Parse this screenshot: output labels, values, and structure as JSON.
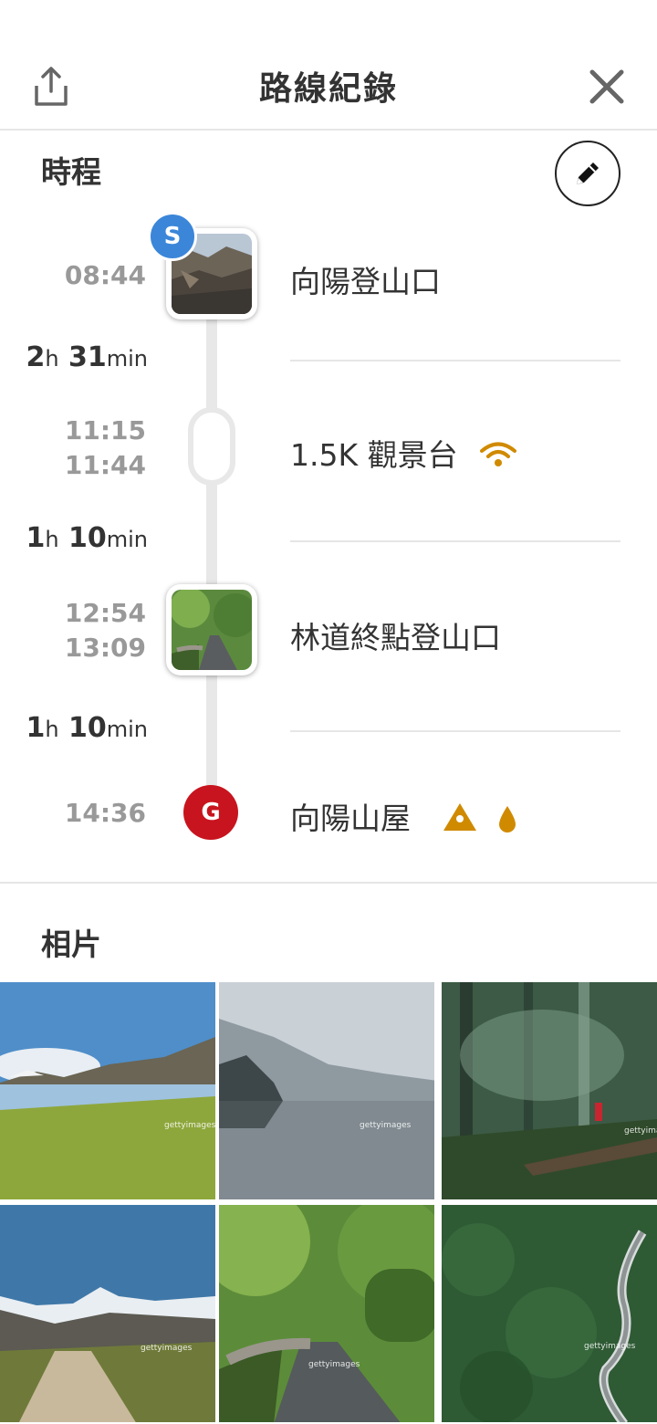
{
  "header": {
    "title": "路線紀錄",
    "share_icon": "share-icon",
    "close_icon": "close-icon"
  },
  "schedule": {
    "section_title": "時程",
    "edit_icon": "pencil-icon",
    "start_badge": "S",
    "goal_badge": "G",
    "stops": [
      {
        "times": [
          "08:44"
        ],
        "name": "向陽登山口"
      },
      {
        "times": [
          "11:15",
          "11:44"
        ],
        "name": "1.5K 觀景台",
        "icons": [
          "signal-icon"
        ]
      },
      {
        "times": [
          "12:54",
          "13:09"
        ],
        "name": "林道終點登山口"
      },
      {
        "times": [
          "14:36"
        ],
        "name": "向陽山屋",
        "icons": [
          "tent-icon",
          "water-drop-icon"
        ]
      }
    ],
    "durations": [
      {
        "h": "2",
        "h_unit": "h",
        "m": "31",
        "m_unit": "min"
      },
      {
        "h": "1",
        "h_unit": "h",
        "m": "10",
        "m_unit": "min"
      },
      {
        "h": "1",
        "h_unit": "h",
        "m": "10",
        "m_unit": "min"
      }
    ]
  },
  "photos": {
    "section_title": "相片",
    "watermark": "gettyimages"
  },
  "colors": {
    "start_badge": "#3b86d9",
    "goal_badge": "#c8141e",
    "amenity_icon": "#d08a00"
  }
}
